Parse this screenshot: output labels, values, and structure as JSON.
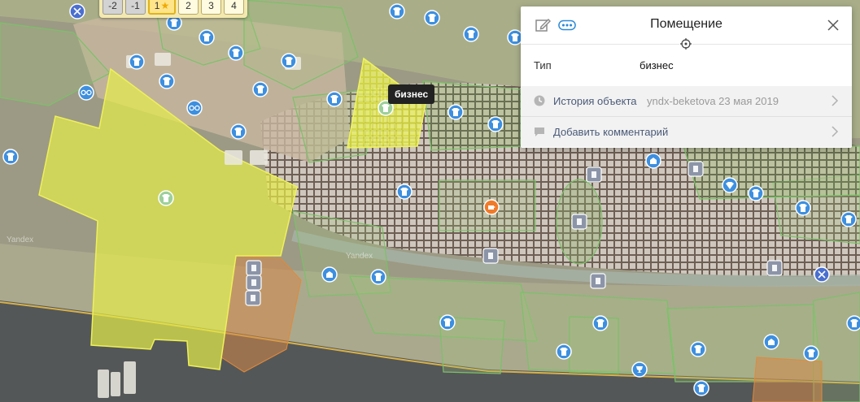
{
  "floors": {
    "buttons": [
      {
        "label": "-2",
        "kind": "neg"
      },
      {
        "label": "-1",
        "kind": "neg"
      },
      {
        "label": "1",
        "kind": "active"
      },
      {
        "label": "2",
        "kind": "normal"
      },
      {
        "label": "3",
        "kind": "normal"
      },
      {
        "label": "4",
        "kind": "normal"
      }
    ],
    "star": "★"
  },
  "tooltip": {
    "text": "бизнес"
  },
  "panel": {
    "title": "Помещение",
    "type_label": "Тип",
    "type_value": "бизнес",
    "history_label": "История объекта",
    "history_meta": "yndx-beketova 23 мая 2019",
    "comment_label": "Добавить комментарий"
  },
  "watermarks": [
    "Yandex",
    "Yandex"
  ],
  "colors": {
    "selected_fill": "#e6ec4a",
    "poi_blue": "#3d8fe0",
    "cafe_orange": "#f07a2a",
    "outline_green": "#6fbf5a"
  },
  "poi_icons": [
    "clothing-icon",
    "scissors-icon",
    "glasses-icon",
    "cafe-icon",
    "info-icon",
    "dolphin-icon",
    "gift-icon",
    "restroom-icon",
    "baby-icon",
    "laundry-icon",
    "diamond-icon",
    "trophy-icon",
    "ticket-icon"
  ]
}
